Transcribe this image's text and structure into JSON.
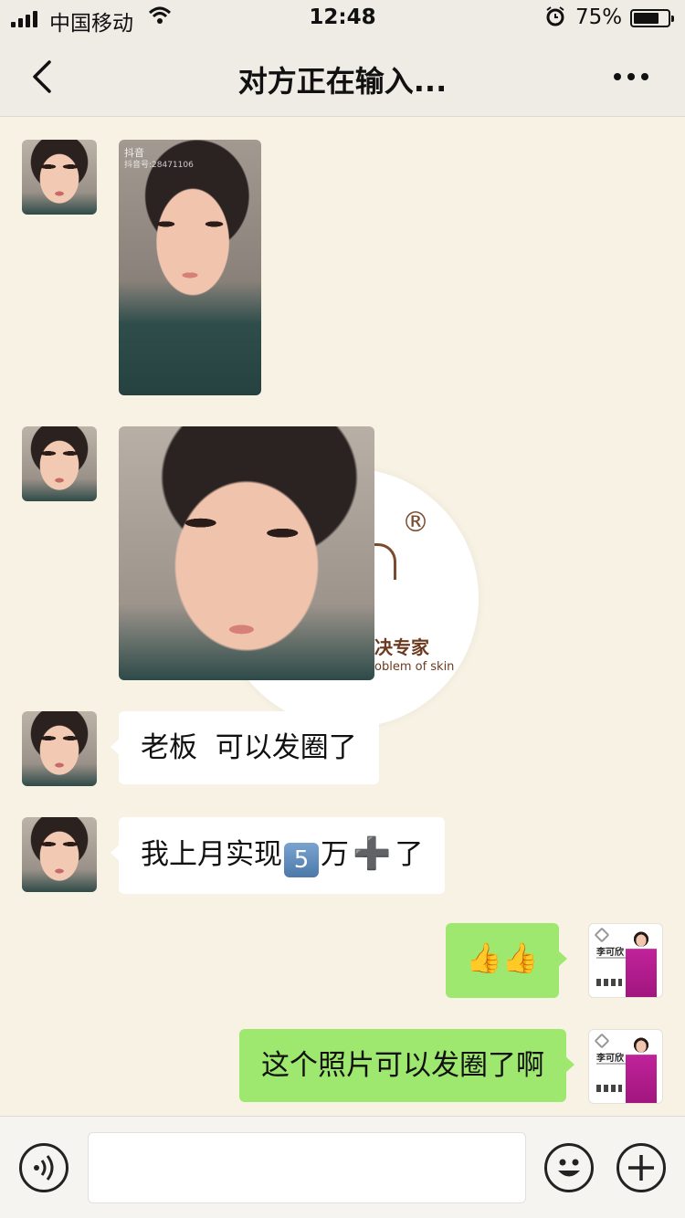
{
  "status_bar": {
    "carrier": "中国移动",
    "time": "12:48",
    "battery": "75%",
    "battery_level": 0.75,
    "signal_bars": 4,
    "icons": [
      "signal-icon",
      "wifi-icon",
      "alarm-icon",
      "battery-icon"
    ]
  },
  "nav": {
    "title": "对方正在输入...",
    "back_icon": "chevron-left-icon",
    "more_icon": "more-dots-icon"
  },
  "messages": [
    {
      "side": "left",
      "type": "image",
      "watermark": "抖音",
      "watermark_id": "抖音号:28471106"
    },
    {
      "side": "left",
      "type": "image",
      "overlay_logo": {
        "mark": "®",
        "text_cn": "决专家",
        "text_en": "oblem of skin"
      }
    },
    {
      "side": "left",
      "type": "text",
      "text": "老板  可以发圈了"
    },
    {
      "side": "left",
      "type": "text",
      "text_before": "我上月实现",
      "keycap": "5",
      "text_mid": "万",
      "plus": "➕",
      "text_after": "了"
    },
    {
      "side": "right",
      "type": "text",
      "emoji": "👍👍",
      "emoji_name": "thumbs-up-icon"
    },
    {
      "side": "right",
      "type": "text",
      "text": "这个照片可以发圈了啊"
    }
  ],
  "my_avatar": {
    "name": "李可欣"
  },
  "input_bar": {
    "value": "",
    "voice_icon": "voice-icon",
    "emoji_icon": "emoji-icon",
    "add_icon": "plus-circle-icon"
  },
  "colors": {
    "chat_background": "#f7f2e3",
    "bar_background": "#efece6",
    "bubble_left": "#ffffff",
    "bubble_right": "#9fe870"
  }
}
